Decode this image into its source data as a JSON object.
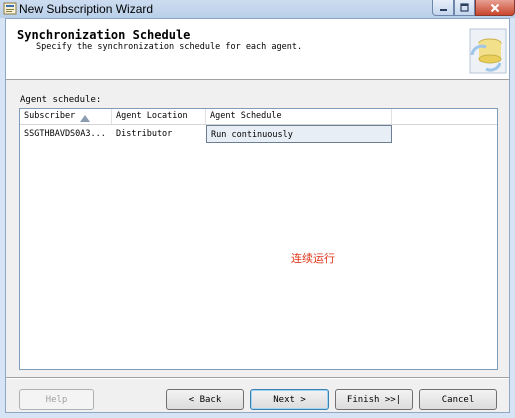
{
  "window": {
    "title": "New Subscription Wizard"
  },
  "header": {
    "title": "Synchronization Schedule",
    "subtitle": "Specify the synchronization schedule for each agent."
  },
  "grid": {
    "label": "Agent schedule:",
    "columns": [
      "Subscriber",
      "Agent Location",
      "Agent Schedule"
    ],
    "sort_column": "Subscriber",
    "sort_direction": "ascending",
    "rows": [
      {
        "subscriber": "SSGTHBAVDS0A3...",
        "agent_location": "Distributor",
        "agent_schedule": "Run continuously"
      }
    ]
  },
  "annotation": "连续运行",
  "buttons": {
    "help": "Help",
    "back": "< Back",
    "next": "Next >",
    "finish": "Finish >>|",
    "cancel": "Cancel"
  },
  "colors": {
    "annotation": "#e0361a",
    "titlebar": "#c4d6ee",
    "close_button": "#c9462c"
  },
  "icons": [
    "wizard-app-icon",
    "minimize-icon",
    "maximize-icon",
    "close-icon",
    "database-sync-graphic",
    "sort-ascending-icon"
  ]
}
